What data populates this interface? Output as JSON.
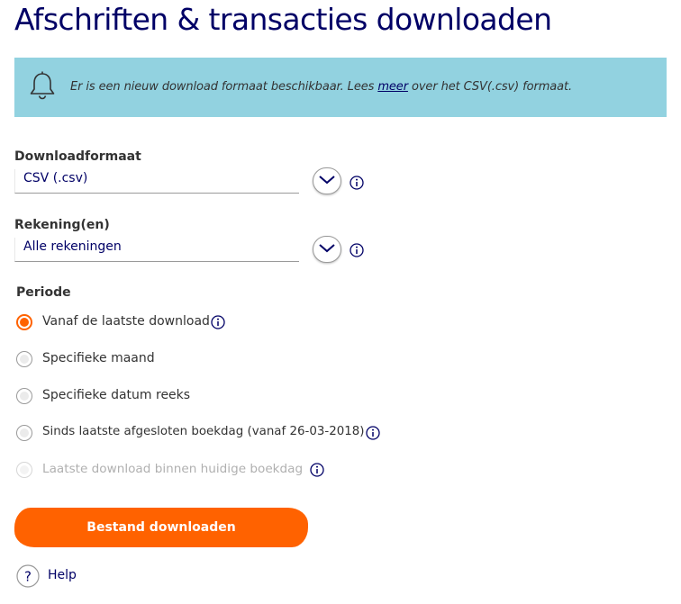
{
  "page": {
    "title": "Afschriften & transacties downloaden"
  },
  "notice": {
    "icon": "bell-icon",
    "text_before": "Er is een nieuw download formaat beschikbaar. Lees ",
    "link": "meer",
    "text_after": " over het CSV(.csv) formaat."
  },
  "format": {
    "label": "Downloadformaat",
    "value": "CSV (.csv)"
  },
  "account": {
    "label": "Rekening(en)",
    "value": "Alle rekeningen"
  },
  "period": {
    "label": "Periode",
    "options": [
      {
        "label": "Vanaf de laatste download",
        "checked": true,
        "disabled": false,
        "info": true
      },
      {
        "label": "Specifieke maand",
        "checked": false,
        "disabled": false,
        "info": false
      },
      {
        "label": "Specifieke datum reeks",
        "checked": false,
        "disabled": false,
        "info": false
      },
      {
        "label": "Sinds laatste afgesloten boekdag (vanaf 26-03-2018)",
        "checked": false,
        "disabled": false,
        "info": true
      },
      {
        "label": "Laatste download binnen huidige boekdag",
        "checked": false,
        "disabled": true,
        "info": true
      }
    ]
  },
  "actions": {
    "download_label": "Bestand downloaden",
    "help_label": "Help"
  },
  "colors": {
    "title": "#000066",
    "accent": "#ff6200",
    "notice_bg": "#92d2e0"
  }
}
